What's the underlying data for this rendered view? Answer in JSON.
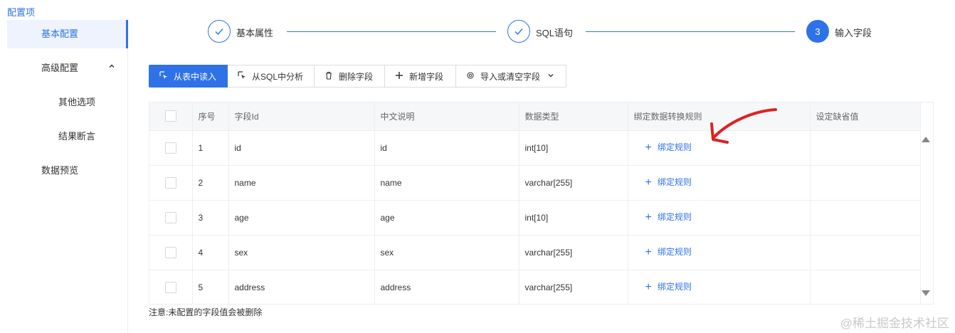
{
  "section_title": "配置项",
  "sidebar": {
    "items": [
      {
        "label": "基本配置"
      },
      {
        "label": "高级配置",
        "chevron": "chevron-up-icon"
      },
      {
        "label": "其他选项"
      },
      {
        "label": "结果断言"
      },
      {
        "label": "数据预览"
      }
    ]
  },
  "steps": [
    {
      "label": "基本属性",
      "status": "done",
      "icon": "check-icon"
    },
    {
      "label": "SQL语句",
      "status": "done",
      "icon": "check-icon"
    },
    {
      "label": "输入字段",
      "status": "current",
      "number": "3"
    }
  ],
  "toolbar": {
    "read_from_table": "从表中读入",
    "analyze_sql": "从SQL中分析",
    "delete_field": "删除字段",
    "add_field": "新增字段",
    "import_or_clear": "导入或清空字段"
  },
  "table": {
    "headers": [
      "序号",
      "字段Id",
      "中文说明",
      "数据类型",
      "绑定数据转换规则",
      "设定缺省值"
    ],
    "rows": [
      {
        "index": "1",
        "field_id": "id",
        "desc": "id",
        "type": "int[10]",
        "rule": "绑定规则",
        "default": ""
      },
      {
        "index": "2",
        "field_id": "name",
        "desc": "name",
        "type": "varchar[255]",
        "rule": "绑定规则",
        "default": ""
      },
      {
        "index": "3",
        "field_id": "age",
        "desc": "age",
        "type": "int[10]",
        "rule": "绑定规则",
        "default": ""
      },
      {
        "index": "4",
        "field_id": "sex",
        "desc": "sex",
        "type": "varchar[255]",
        "rule": "绑定规则",
        "default": ""
      },
      {
        "index": "5",
        "field_id": "address",
        "desc": "address",
        "type": "varchar[255]",
        "rule": "绑定规则",
        "default": ""
      }
    ]
  },
  "footnote": "注意:未配置的字段值会被删除",
  "watermark": "@稀土掘金技术社区",
  "colors": {
    "accent": "#2f72e8",
    "annotation": "#e02020"
  }
}
